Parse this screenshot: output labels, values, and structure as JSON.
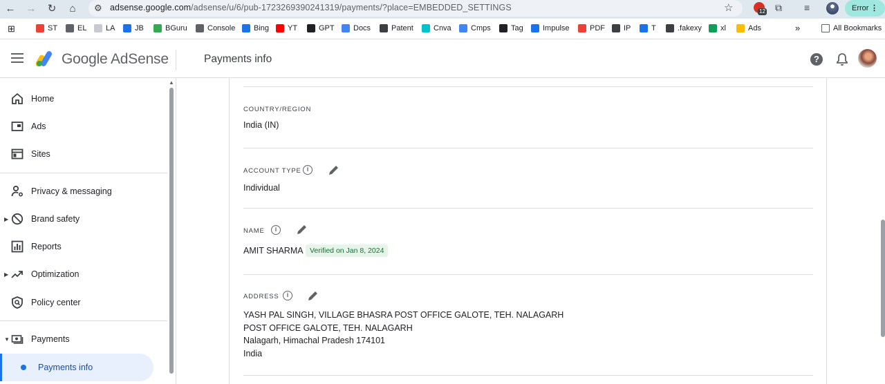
{
  "browser": {
    "url_host": "adsense.google.com",
    "url_path": "/adsense/u/6/pub-1723269390241319/payments/?place=EMBEDDED_SETTINGS",
    "extension_badge": "12",
    "profile_status": "Error"
  },
  "bookmarks": [
    {
      "label": "ST",
      "color": "#ea4335"
    },
    {
      "label": "EL",
      "color": "#5f6368"
    },
    {
      "label": "LA",
      "color": "#c7cbd1"
    },
    {
      "label": "JB",
      "color": "#1a73e8"
    },
    {
      "label": "BGuru",
      "color": "#34a853"
    },
    {
      "label": "Console",
      "color": "#5f6368"
    },
    {
      "label": "Bing",
      "color": "#1a73e8"
    },
    {
      "label": "YT",
      "color": "#ff0000"
    },
    {
      "label": "GPT",
      "color": "#202124"
    },
    {
      "label": "Docs",
      "color": "#4285f4"
    },
    {
      "label": "Patent",
      "color": "#3c4043"
    },
    {
      "label": "Cnva",
      "color": "#00c4cc"
    },
    {
      "label": "Cmps",
      "color": "#4285f4"
    },
    {
      "label": "Tag",
      "color": "#202124"
    },
    {
      "label": "Impulse",
      "color": "#1a73e8"
    },
    {
      "label": "PDF",
      "color": "#ea4335"
    },
    {
      "label": "IP",
      "color": "#3c4043"
    },
    {
      "label": "T",
      "color": "#1a73e8"
    },
    {
      "label": ".fakexy",
      "color": "#3c4043"
    },
    {
      "label": "xl",
      "color": "#0f9d58"
    },
    {
      "label": "Ads",
      "color": "#fbbc04"
    }
  ],
  "bookmarks_overflow": "»",
  "all_bookmarks": "All Bookmarks",
  "app": {
    "brand": "Google AdSense",
    "page_title": "Payments info"
  },
  "sidebar": {
    "items": [
      {
        "label": "Home"
      },
      {
        "label": "Ads"
      },
      {
        "label": "Sites"
      },
      {
        "label": "Privacy & messaging"
      },
      {
        "label": "Brand safety"
      },
      {
        "label": "Reports"
      },
      {
        "label": "Optimization"
      },
      {
        "label": "Policy center"
      },
      {
        "label": "Payments"
      },
      {
        "label": "Payments info"
      }
    ]
  },
  "fields": {
    "country_label": "COUNTRY/REGION",
    "country_value": "India (IN)",
    "account_type_label": "ACCOUNT TYPE",
    "account_type_value": "Individual",
    "name_label": "NAME",
    "name_value": "AMIT SHARMA",
    "name_verified": "Verified on Jan 8, 2024",
    "address_label": "ADDRESS",
    "address_lines": [
      "YASH PAL SINGH, VILLAGE BHASRA POST OFFICE GALOTE, TEH. NALAGARH",
      "POST OFFICE GALOTE, TEH. NALAGARH",
      "Nalagarh, Himachal Pradesh 174101",
      "India"
    ]
  },
  "colors": {
    "accent": "#1a73e8",
    "verified_bg": "#e6f4ea",
    "verified_text": "#137333",
    "active_nav_bg": "#e8f0fe"
  }
}
